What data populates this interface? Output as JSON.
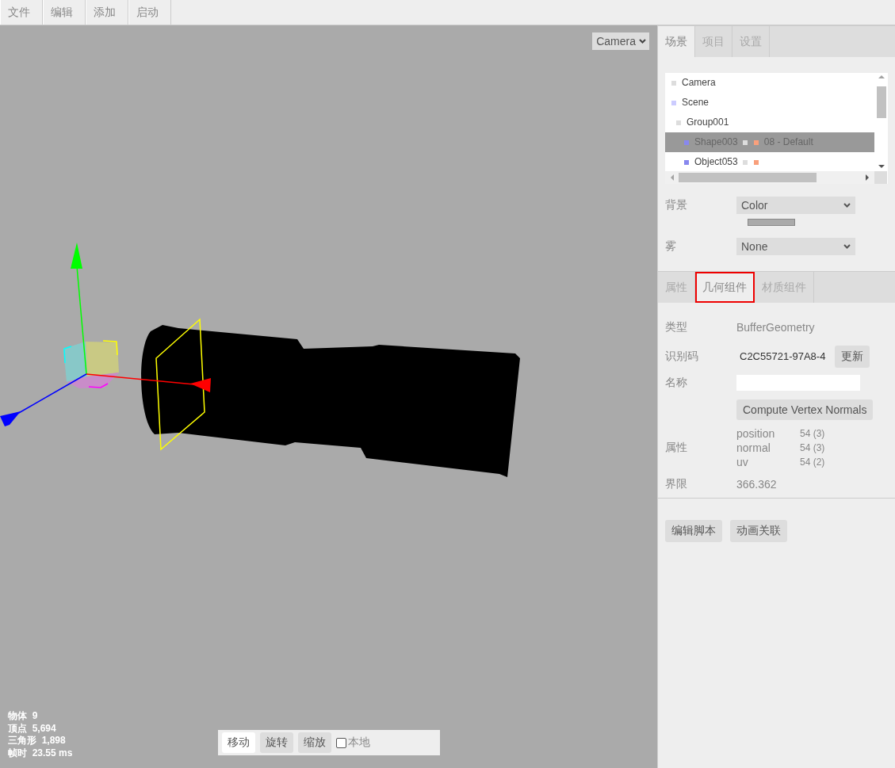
{
  "menubar": [
    {
      "label": "文件"
    },
    {
      "label": "编辑"
    },
    {
      "label": "添加"
    },
    {
      "label": "启动"
    }
  ],
  "viewport": {
    "camera_select": "Camera",
    "info": [
      {
        "label": "物体",
        "value": "9"
      },
      {
        "label": "顶点",
        "value": "5,694"
      },
      {
        "label": "三角形",
        "value": "1,898"
      },
      {
        "label": "帧时",
        "value": "23.55 ms"
      }
    ],
    "toolbar": {
      "buttons": [
        {
          "label": "移动",
          "selected": true
        },
        {
          "label": "旋转",
          "selected": false
        },
        {
          "label": "缩放",
          "selected": false
        }
      ],
      "local": {
        "label": "本地",
        "checked": false
      }
    }
  },
  "sidebar": {
    "tabs": [
      {
        "label": "场景",
        "selected": true
      },
      {
        "label": "项目",
        "selected": false
      },
      {
        "label": "设置",
        "selected": false
      }
    ],
    "outliner": [
      {
        "name": "Camera",
        "color": "#dddddd",
        "selected": false
      },
      {
        "name": "Scene",
        "color": "#ccccff",
        "selected": false,
        "children": [
          {
            "name": "Group001",
            "color": "#dddddd",
            "selected": false,
            "children": [
              {
                "name": "Shape003",
                "kind": "mesh",
                "color": "#8888ee",
                "selected": true,
                "material": "08 - Default"
              },
              {
                "name": "Object053",
                "kind": "mesh",
                "color": "#8888ee",
                "selected": false
              }
            ]
          }
        ]
      }
    ],
    "background": {
      "label": "背景",
      "value": "Color",
      "color": "#aaaaaa"
    },
    "fog": {
      "label": "雾",
      "value": "None"
    },
    "panel_tabs": [
      {
        "label": "属性",
        "selected": false
      },
      {
        "label": "几何组件",
        "selected": true
      },
      {
        "label": "材质组件",
        "selected": false
      }
    ],
    "geometry": {
      "type": {
        "label": "类型",
        "value": "BufferGeometry"
      },
      "uuid": {
        "label": "识别码",
        "value": "C2C55721-97A8-4",
        "button": "更新"
      },
      "name": {
        "label": "名称"
      },
      "compute_button": "Compute Vertex Normals",
      "attributes": {
        "label": "属性",
        "rows": [
          {
            "name": "position",
            "value": "54 (3)"
          },
          {
            "name": "normal",
            "value": "54 (3)"
          },
          {
            "name": "uv",
            "value": "54 (2)"
          }
        ]
      },
      "bounds": {
        "label": "界限",
        "value": "366.362"
      }
    },
    "script_buttons": [
      {
        "label": "编辑脚本"
      },
      {
        "label": "动画关联"
      }
    ]
  }
}
